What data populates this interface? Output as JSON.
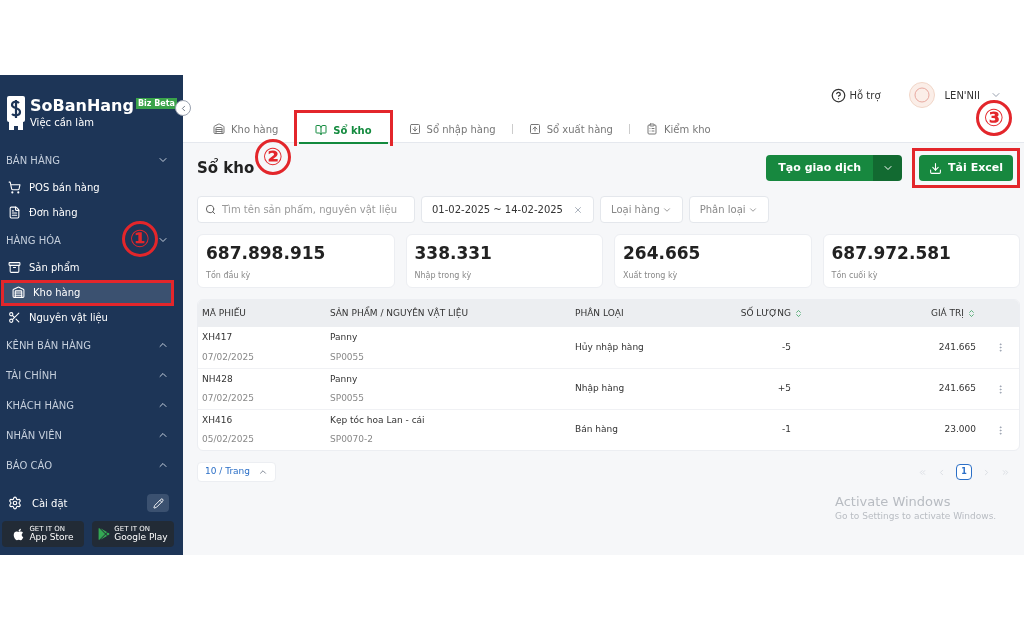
{
  "sidebar": {
    "brand": "SoBanHang",
    "badge": "Biz Beta",
    "subtitle": "Việc cần làm",
    "sections": [
      {
        "title": "BÁN HÀNG",
        "expanded": true,
        "items": [
          {
            "label": "POS bán hàng",
            "selected": false,
            "highlighted": false
          },
          {
            "label": "Đơn hàng",
            "selected": false,
            "highlighted": false
          }
        ]
      },
      {
        "title": "HÀNG HÓA",
        "expanded": true,
        "marker": "①",
        "items": [
          {
            "label": "Sản phẩm",
            "selected": false,
            "highlighted": false
          },
          {
            "label": "Kho hàng",
            "selected": true,
            "highlighted": true
          },
          {
            "label": "Nguyên vật liệu",
            "selected": false,
            "highlighted": false
          }
        ]
      },
      {
        "title": "KÊNH BÁN HÀNG",
        "expanded": false
      },
      {
        "title": "TÀI CHÍNH",
        "expanded": false
      },
      {
        "title": "KHÁCH HÀNG",
        "expanded": false
      },
      {
        "title": "NHÂN VIÊN",
        "expanded": false
      },
      {
        "title": "BÁO CÁO",
        "expanded": false
      }
    ],
    "settings": "Cài đặt",
    "stores": [
      {
        "kind": "apple",
        "small": "GET IT ON",
        "label": "App Store"
      },
      {
        "kind": "google",
        "small": "GET IT ON",
        "label": "Google Play"
      }
    ]
  },
  "header": {
    "help": "Hỗ trợ",
    "user": "LEN'NII"
  },
  "tabs": [
    {
      "label": "Kho hàng",
      "selected": false,
      "highlighted": false,
      "separator": false
    },
    {
      "label": "Sổ kho",
      "selected": true,
      "highlighted": true,
      "separator": false
    },
    {
      "label": "Sổ nhập hàng",
      "selected": false,
      "highlighted": false,
      "separator": false
    },
    {
      "label": "Sổ xuất hàng",
      "selected": false,
      "highlighted": false,
      "separator": true
    },
    {
      "label": "Kiểm kho",
      "selected": false,
      "highlighted": false,
      "separator": true
    }
  ],
  "page": {
    "title": "Sổ kho",
    "marker": "②",
    "create_button": "Tạo giao dịch",
    "excel_button": {
      "label": "Tải Excel",
      "highlighted": true,
      "marker": "③"
    }
  },
  "filters": {
    "search": {
      "placeholder": "Tìm tên sản phẩm, nguyên vật liệu"
    },
    "date_range": "01-02-2025 ~ 14-02-2025",
    "dropdowns": [
      "Loại hàng",
      "Phân loại"
    ]
  },
  "stats": [
    {
      "value": "687.898.915",
      "label": "Tồn đầu kỳ"
    },
    {
      "value": "338.331",
      "label": "Nhập trong kỳ"
    },
    {
      "value": "264.665",
      "label": "Xuất trong kỳ"
    },
    {
      "value": "687.972.581",
      "label": "Tồn cuối kỳ"
    }
  ],
  "table": {
    "columns": [
      {
        "label": "MÃ PHIẾU",
        "sortable": false
      },
      {
        "label": "SẢN PHẨM / NGUYÊN VẬT LIỆU",
        "sortable": false
      },
      {
        "label": "PHÂN LOẠI",
        "sortable": false
      },
      {
        "label": "SỐ LƯỢNG",
        "sortable": true
      },
      {
        "label": "GIÁ TRỊ",
        "sortable": true
      }
    ],
    "rows": [
      {
        "code": "XH417",
        "date": "07/02/2025",
        "product": "Panny",
        "sku": "SP0055",
        "type": "Hủy nhập hàng",
        "quantity": "-5",
        "value": "241.665"
      },
      {
        "code": "NH428",
        "date": "07/02/2025",
        "product": "Panny",
        "sku": "SP0055",
        "type": "Nhập hàng",
        "quantity": "+5",
        "value": "241.665"
      },
      {
        "code": "XH416",
        "date": "05/02/2025",
        "product": "Kẹp tóc hoa Lan - cái",
        "sku": "SP0070-2",
        "type": "Bán hàng",
        "quantity": "-1",
        "value": "23.000"
      }
    ]
  },
  "page_size": "10 / Trang",
  "pagination": {
    "pages": [
      {
        "label": "1",
        "selected": true
      }
    ]
  },
  "os_notice": {
    "title": "Activate Windows",
    "text": "Go to Settings to activate Windows."
  }
}
